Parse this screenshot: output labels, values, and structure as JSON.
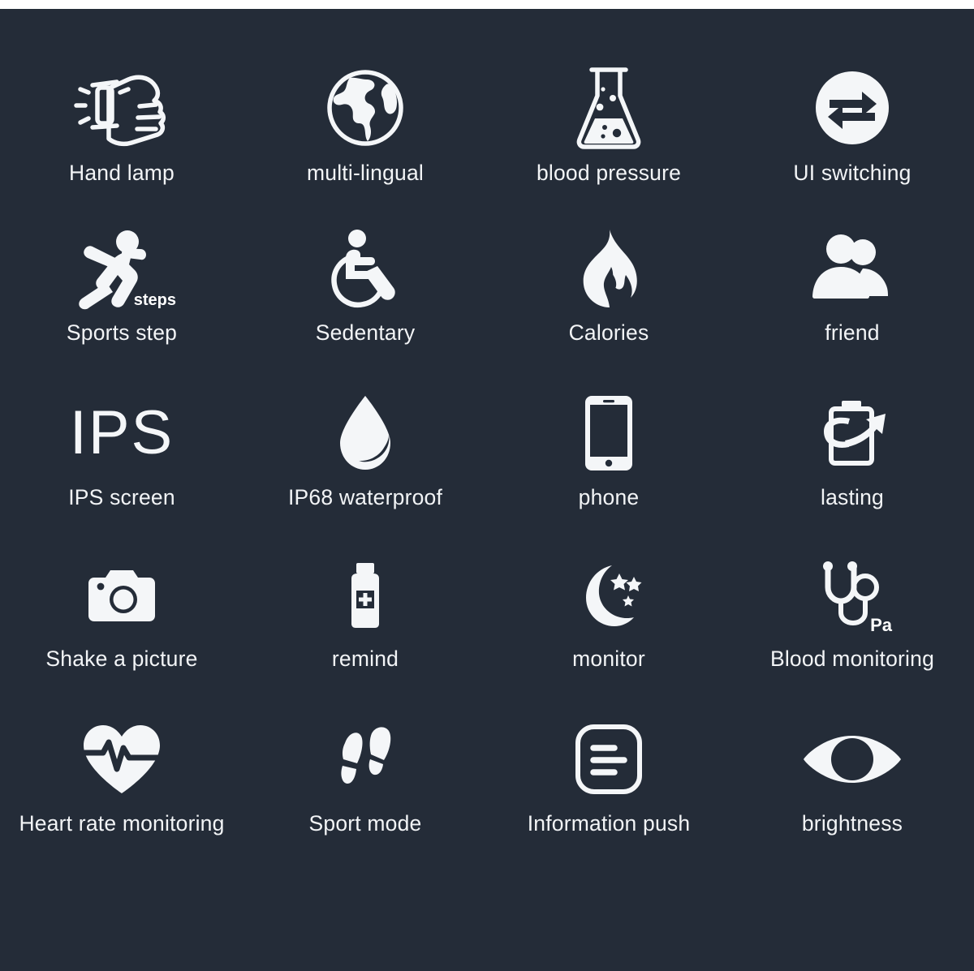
{
  "page": {
    "background_color": "#242c38",
    "top_strip_color": "#ffffff",
    "icon_color": "#f4f6f8",
    "label_color": "#f2f4f6"
  },
  "features": [
    {
      "icon": "fist-watch-lamp-icon",
      "label": "Hand lamp",
      "badge": ""
    },
    {
      "icon": "globe-icon",
      "label": "multi-lingual",
      "badge": ""
    },
    {
      "icon": "flask-icon",
      "label": "blood pressure",
      "badge": ""
    },
    {
      "icon": "switch-arrows-circle-icon",
      "label": "UI switching",
      "badge": ""
    },
    {
      "icon": "running-person-icon",
      "label": "Sports step",
      "badge": "steps"
    },
    {
      "icon": "wheelchair-icon",
      "label": "Sedentary",
      "badge": ""
    },
    {
      "icon": "flame-icon",
      "label": "Calories",
      "badge": ""
    },
    {
      "icon": "two-people-icon",
      "label": "friend",
      "badge": ""
    },
    {
      "icon": "ips-text-icon",
      "label": "IPS screen",
      "badge": "",
      "text_glyph": "IPS"
    },
    {
      "icon": "water-drop-icon",
      "label": "IP68 waterproof",
      "badge": ""
    },
    {
      "icon": "smartphone-icon",
      "label": "phone",
      "badge": ""
    },
    {
      "icon": "battery-arrow-icon",
      "label": "lasting",
      "badge": ""
    },
    {
      "icon": "camera-icon",
      "label": "Shake a picture",
      "badge": ""
    },
    {
      "icon": "medicine-bottle-icon",
      "label": "remind",
      "badge": ""
    },
    {
      "icon": "moon-stars-icon",
      "label": "monitor",
      "badge": ""
    },
    {
      "icon": "stethoscope-icon",
      "label": "Blood monitoring",
      "badge": "Pa"
    },
    {
      "icon": "heart-pulse-icon",
      "label": "Heart rate monitoring",
      "badge": ""
    },
    {
      "icon": "footprints-icon",
      "label": "Sport mode",
      "badge": ""
    },
    {
      "icon": "document-lines-icon",
      "label": "Information push",
      "badge": ""
    },
    {
      "icon": "eye-icon",
      "label": "brightness",
      "badge": ""
    }
  ]
}
